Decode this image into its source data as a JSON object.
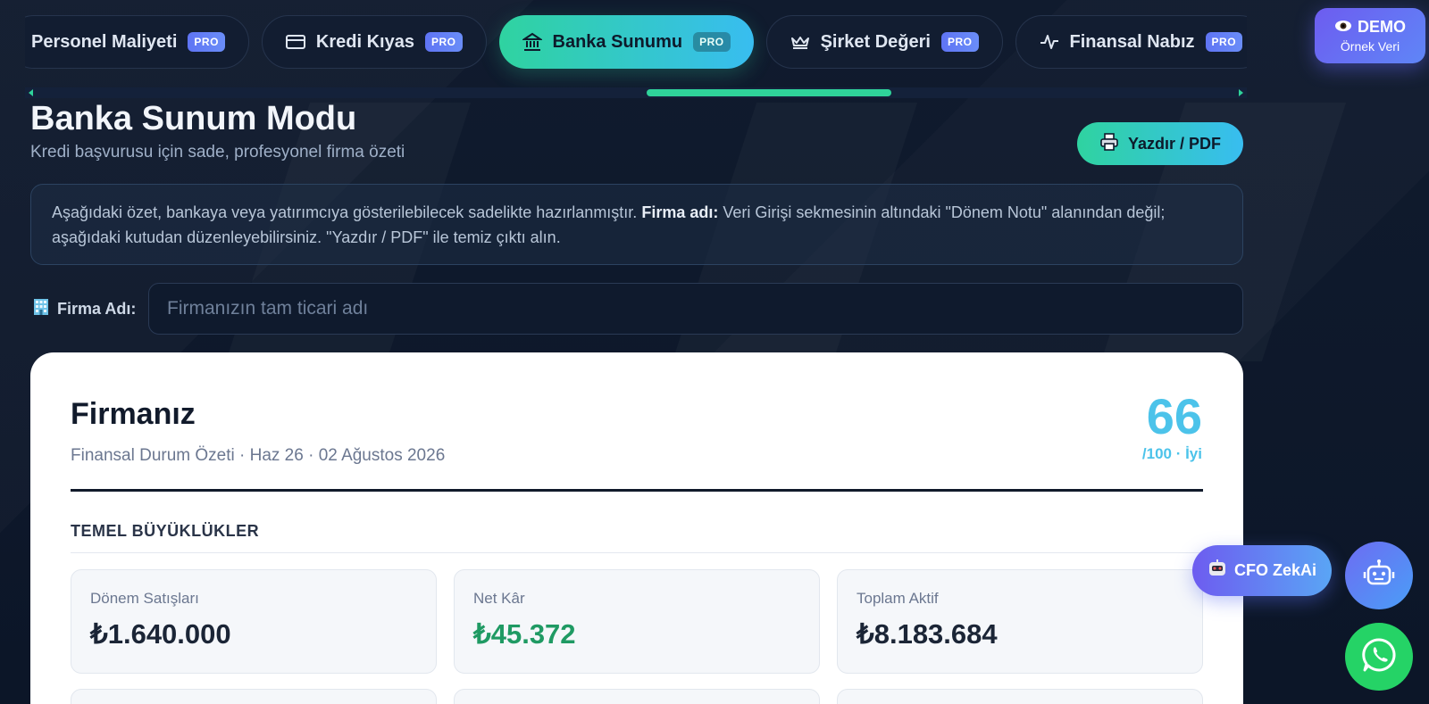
{
  "tabs": [
    {
      "label": "Personel Maliyeti",
      "badge": "PRO",
      "icon": "people-icon"
    },
    {
      "label": "Kredi Kıyas",
      "badge": "PRO",
      "icon": "credit-card-icon"
    },
    {
      "label": "Banka Sunumu",
      "badge": "PRO",
      "icon": "bank-icon",
      "active": true
    },
    {
      "label": "Şirket Değeri",
      "badge": "PRO",
      "icon": "crown-icon"
    },
    {
      "label": "Finansal Nabız",
      "badge": "PRO",
      "icon": "pulse-icon"
    }
  ],
  "demo": {
    "title": "DEMO",
    "subtitle": "Örnek Veri"
  },
  "header": {
    "title": "Banka Sunum Modu",
    "subtitle": "Kredi başvurusu için sade, profesyonel firma özeti",
    "print_label": "Yazdır / PDF"
  },
  "info": {
    "text_before": "Aşağıdaki özet, bankaya veya yatırımcıya gösterilebilecek sadelikte hazırlanmıştır.",
    "bold": "Firma adı:",
    "text_after": "Veri Girişi sekmesinin altındaki \"Dönem Notu\" alanından değil; aşağıdaki kutudan düzenleyebilirsiniz. \"Yazdır / PDF\" ile temiz çıktı alın."
  },
  "firm": {
    "label": "Firma Adı:",
    "placeholder": "Firmanızın tam ticari adı",
    "value": ""
  },
  "card": {
    "title": "Firmanız",
    "meta": "Finansal Durum Özeti · Haz 26 · 02 Ağustos 2026",
    "score": "66",
    "score_label": "/100 · İyi",
    "section": "TEMEL BÜYÜKLÜKLER",
    "metrics": [
      {
        "label": "Dönem Satışları",
        "value": "₺1.640.000"
      },
      {
        "label": "Net Kâr",
        "value": "₺45.372"
      },
      {
        "label": "Toplam Aktif",
        "value": "₺8.183.684"
      }
    ]
  },
  "cfo": {
    "label": "CFO ZekAi"
  },
  "colors": {
    "accent_green": "#2fd3a0",
    "accent_blue": "#38bdf0",
    "accent_purple": "#6d5cf0",
    "profit_green": "#1f9a63",
    "score_blue": "#4cc3ea"
  }
}
